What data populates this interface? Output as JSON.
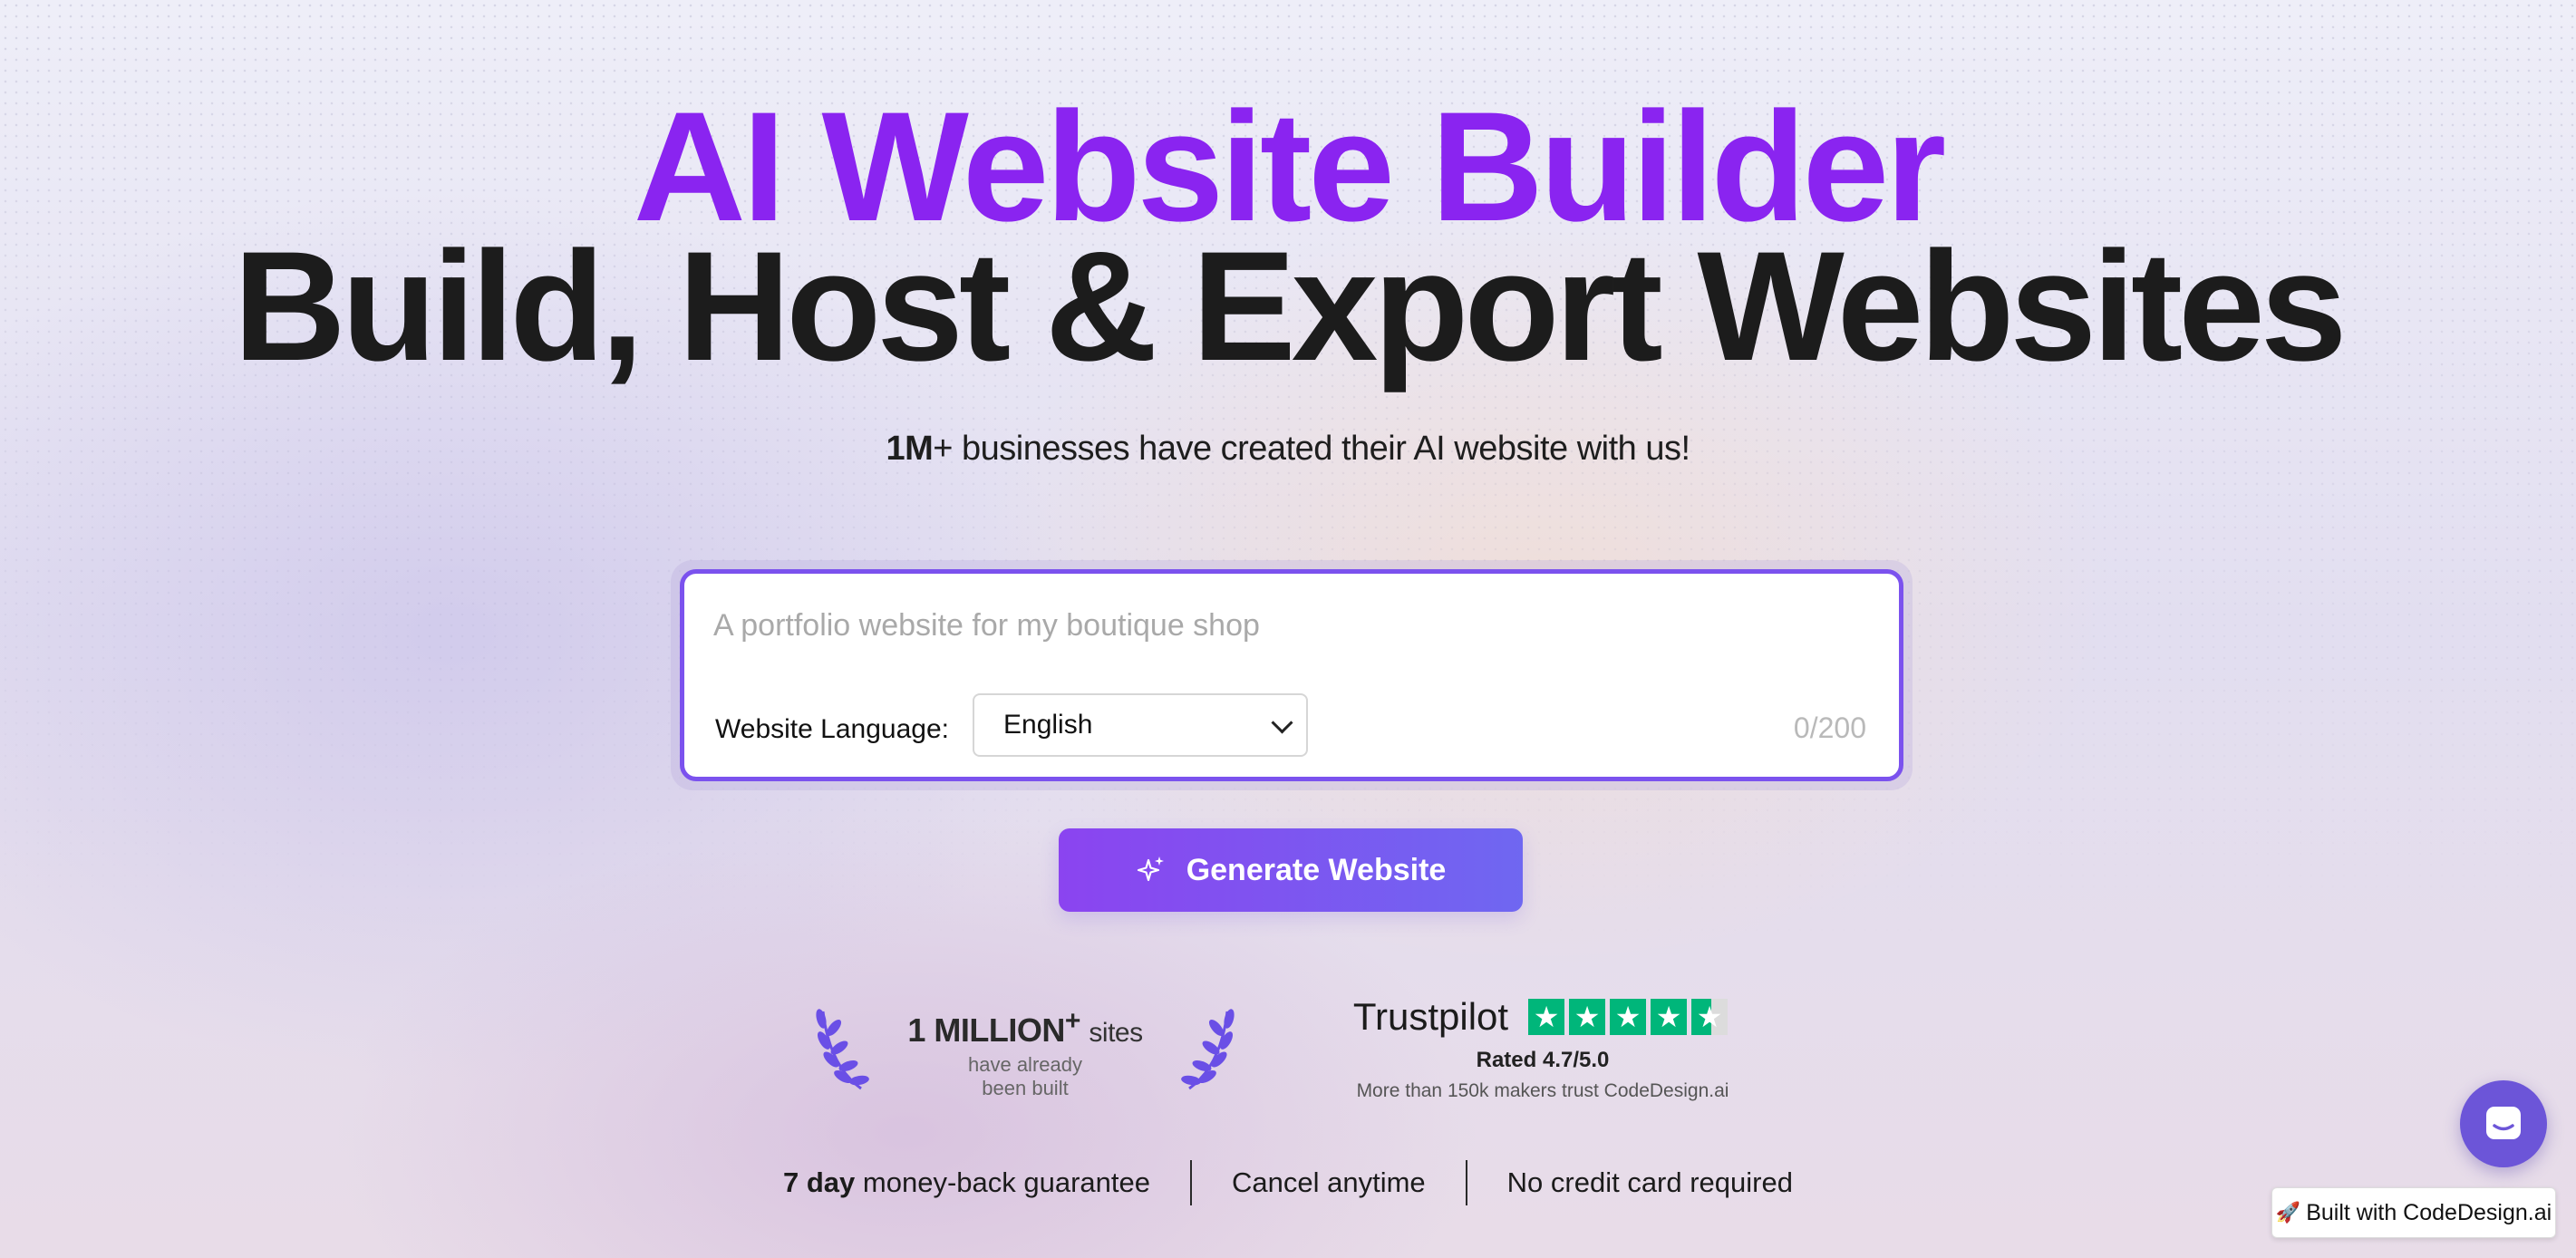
{
  "hero": {
    "title_accent": "AI Website Builder",
    "title_main": "Build, Host & Export Websites",
    "subline_bold": "1M",
    "subline_rest": "+ businesses have created their AI website with us!"
  },
  "prompt": {
    "placeholder": "A portfolio website for my boutique shop",
    "value": "",
    "language_label": "Website Language:",
    "language_selected": "English",
    "char_count": "0/200"
  },
  "generate_button": {
    "label": "Generate Website",
    "icon": "sparkle-icon"
  },
  "stats": {
    "million_count": "1 MILLION",
    "million_plus": "+",
    "million_unit": "sites",
    "million_caption_line1": "have already",
    "million_caption_line2": "been built",
    "icons": [
      "laurel-left-icon",
      "laurel-right-icon"
    ]
  },
  "trustpilot": {
    "brand": "Trustpilot",
    "rating_text": "Rated 4.7/5.0",
    "makers_text": "More than 150k makers trust CodeDesign.ai",
    "stars_filled": 4.5,
    "stars_total": 5
  },
  "guarantees": {
    "money_back_bold": "7 day",
    "money_back_rest": " money-back guarantee",
    "cancel": "Cancel anytime",
    "no_card": "No credit card required"
  },
  "chat_widget": {
    "icon": "chat-icon"
  },
  "built_badge": {
    "icon": "rocket-icon",
    "label": "Built with CodeDesign.ai"
  },
  "colors": {
    "accent_purple": "#8a24f0",
    "button_gradient_start": "#8b44f0",
    "button_gradient_end": "#6f67f1",
    "prompt_border": "#7b52ee",
    "trustpilot_green": "#00b67a",
    "chat_bubble": "#6c55d8"
  }
}
